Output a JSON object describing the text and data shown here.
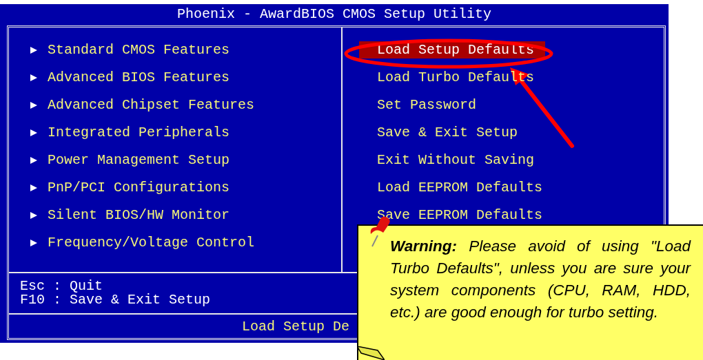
{
  "window": {
    "title": "Phoenix - AwardBIOS CMOS Setup Utility"
  },
  "left_menu": [
    {
      "label": "Standard CMOS Features"
    },
    {
      "label": "Advanced BIOS Features"
    },
    {
      "label": "Advanced Chipset Features"
    },
    {
      "label": "Integrated Peripherals"
    },
    {
      "label": "Power Management Setup"
    },
    {
      "label": "PnP/PCI Configurations"
    },
    {
      "label": "Silent BIOS/HW Monitor"
    },
    {
      "label": "Frequency/Voltage Control"
    }
  ],
  "right_menu": [
    {
      "label": "Load Setup Defaults",
      "selected": true
    },
    {
      "label": "Load Turbo Defaults",
      "selected": false
    },
    {
      "label": "Set Password",
      "selected": false
    },
    {
      "label": "Save & Exit Setup",
      "selected": false
    },
    {
      "label": "Exit Without Saving",
      "selected": false
    },
    {
      "label": "Load EEPROM Defaults",
      "selected": false
    },
    {
      "label": "Save EEPROM Defaults",
      "selected": false
    }
  ],
  "help": [
    "Esc : Quit",
    "F10 : Save & Exit Setup"
  ],
  "status_bar": "Load Setup De",
  "callout": {
    "text": "**Warning:** Please avoid of using \"Load Turbo Defaults\", unless you are sure your system components (CPU, RAM, HDD, etc.) are good enough for turbo setting."
  }
}
